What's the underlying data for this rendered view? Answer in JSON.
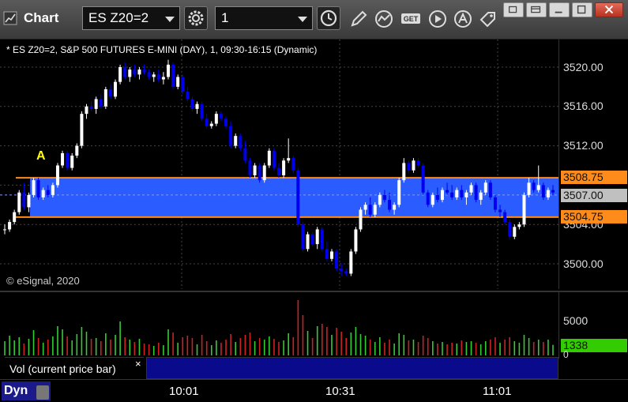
{
  "window": {
    "title": "Chart"
  },
  "toolbar": {
    "symbol_value": "ES Z20=2",
    "interval_value": "1"
  },
  "chart": {
    "title": "* ES Z20=2, S&P 500 FUTURES E-MINI (DAY), 1, 09:30-16:15 (Dynamic)",
    "copyright": "© eSignal, 2020",
    "marker_label": "A",
    "price_axis": {
      "ticks": [
        "3520.00",
        "3516.00",
        "3512.00",
        "3504.00",
        "3500.00"
      ],
      "upper_level": "3508.75",
      "current_price": "3507.00",
      "lower_level": "3504.75"
    },
    "volume_axis": {
      "ticks": [
        "5000",
        "0"
      ],
      "current_volume": "1338"
    },
    "volume_label": "Vol (current price bar)",
    "volume_close": "×",
    "time_axis": [
      "10:01",
      "10:31",
      "11:01"
    ],
    "mode_label": "Dyn",
    "colors": {
      "up_candle": "#ffffff",
      "down_candle": "#0000ee",
      "zone_fill": "#2a5cff",
      "level_line": "#ff8c1a",
      "vol_up": "#33cc33",
      "vol_down": "#cc2222",
      "price_badge": "#ff8c1a",
      "current_badge": "#c0c0c0",
      "vol_badge": "#33cc00"
    }
  },
  "chart_data": {
    "type": "candlestick",
    "title": "* ES Z20=2, S&P 500 FUTURES E-MINI (DAY), 1, 09:30-16:15 (Dynamic)",
    "xlabel": "",
    "ylabel": "",
    "ylim": [
      3497.5,
      3522.5
    ],
    "zone": [
      3504.75,
      3508.75
    ],
    "time_ticks": [
      "10:01",
      "10:31",
      "11:01"
    ],
    "candles": [
      [
        3503.5,
        3504,
        3503,
        3503.5
      ],
      [
        3503.5,
        3504.5,
        3503.25,
        3504.25
      ],
      [
        3504.25,
        3505.5,
        3504,
        3505.25
      ],
      [
        3505.25,
        3507.5,
        3505,
        3507.25
      ],
      [
        3507.25,
        3508.25,
        3505.5,
        3505.75
      ],
      [
        3505.75,
        3507.25,
        3505.25,
        3507
      ],
      [
        3507,
        3508.75,
        3506.75,
        3508.5
      ],
      [
        3508.5,
        3508.75,
        3506.5,
        3506.75
      ],
      [
        3506.75,
        3507.75,
        3506.5,
        3507.5
      ],
      [
        3507.5,
        3508,
        3506.75,
        3507
      ],
      [
        3507,
        3508.25,
        3506.75,
        3508
      ],
      [
        3508,
        3510.25,
        3507.75,
        3510
      ],
      [
        3510,
        3511.5,
        3509.75,
        3511.25
      ],
      [
        3511.25,
        3511.5,
        3509.5,
        3509.75
      ],
      [
        3509.75,
        3511.25,
        3509.5,
        3511
      ],
      [
        3511,
        3512.25,
        3510.75,
        3512
      ],
      [
        3512,
        3515.5,
        3511.75,
        3515.25
      ],
      [
        3515.25,
        3516.25,
        3514.75,
        3516
      ],
      [
        3516,
        3516.5,
        3515.5,
        3515.75
      ],
      [
        3515.75,
        3517,
        3515.25,
        3516.75
      ],
      [
        3516.75,
        3517.25,
        3515.75,
        3516
      ],
      [
        3516,
        3518,
        3515.75,
        3517.75
      ],
      [
        3517.75,
        3518.25,
        3516.75,
        3517
      ],
      [
        3517,
        3518.75,
        3516.75,
        3518.5
      ],
      [
        3518.5,
        3520.25,
        3518.25,
        3520
      ],
      [
        3520,
        3520.5,
        3518.75,
        3519
      ],
      [
        3519,
        3520,
        3518.5,
        3519.75
      ],
      [
        3519.75,
        3520.25,
        3519,
        3519.25
      ],
      [
        3519.25,
        3520,
        3518.75,
        3519.75
      ],
      [
        3519.75,
        3520.25,
        3519.25,
        3519.5
      ],
      [
        3519.5,
        3519.75,
        3518.75,
        3519
      ],
      [
        3519,
        3519.5,
        3518.5,
        3519.25
      ],
      [
        3519.25,
        3519.75,
        3518.5,
        3518.75
      ],
      [
        3518.75,
        3519.5,
        3518.25,
        3519
      ],
      [
        3519,
        3520.75,
        3518.75,
        3520.25
      ],
      [
        3520.25,
        3520.5,
        3517.75,
        3518
      ],
      [
        3518,
        3519.25,
        3517.75,
        3519
      ],
      [
        3519,
        3519.25,
        3517.25,
        3517.5
      ],
      [
        3517.5,
        3518,
        3516.5,
        3516.75
      ],
      [
        3516.75,
        3517,
        3515.5,
        3515.75
      ],
      [
        3515.75,
        3516.5,
        3515.25,
        3516.25
      ],
      [
        3516.25,
        3516.5,
        3514.5,
        3514.75
      ],
      [
        3514.75,
        3515.25,
        3513.75,
        3514
      ],
      [
        3514,
        3514.5,
        3513.75,
        3514.25
      ],
      [
        3514.25,
        3515.5,
        3514,
        3515.25
      ],
      [
        3515.25,
        3515.5,
        3514.5,
        3514.75
      ],
      [
        3514.75,
        3515,
        3513.75,
        3514
      ],
      [
        3514,
        3514.5,
        3511.75,
        3512
      ],
      [
        3512,
        3513.25,
        3511.75,
        3513
      ],
      [
        3513,
        3513.25,
        3511.5,
        3511.75
      ],
      [
        3511.75,
        3512.5,
        3510.25,
        3510.5
      ],
      [
        3510.5,
        3510.75,
        3508.75,
        3509
      ],
      [
        3509,
        3510.25,
        3508.75,
        3510
      ],
      [
        3510,
        3510.25,
        3508.25,
        3508.5
      ],
      [
        3508.5,
        3510.25,
        3508.25,
        3510
      ],
      [
        3510,
        3511.75,
        3509.75,
        3511.5
      ],
      [
        3511.5,
        3511.75,
        3509.5,
        3509.75
      ],
      [
        3509.75,
        3510.25,
        3508.75,
        3509
      ],
      [
        3509,
        3510.75,
        3508.75,
        3510.5
      ],
      [
        3510.5,
        3512.75,
        3510.25,
        3510.75
      ],
      [
        3510.75,
        3511,
        3509.25,
        3509.5
      ],
      [
        3509.5,
        3509.75,
        3503.75,
        3504
      ],
      [
        3504,
        3504.25,
        3501.25,
        3501.5
      ],
      [
        3501.5,
        3503.25,
        3501.25,
        3503
      ],
      [
        3503,
        3503.25,
        3501.75,
        3502
      ],
      [
        3502,
        3503.75,
        3501.5,
        3503.5
      ],
      [
        3503.5,
        3503.75,
        3501.25,
        3501.5
      ],
      [
        3501.5,
        3502.25,
        3500.25,
        3500.5
      ],
      [
        3500.5,
        3501.5,
        3500.25,
        3501.25
      ],
      [
        3501.25,
        3501.5,
        3499.25,
        3499.5
      ],
      [
        3499.5,
        3500,
        3498.75,
        3499.25
      ],
      [
        3499.25,
        3499.5,
        3498.75,
        3499
      ],
      [
        3499,
        3501.5,
        3498.75,
        3501.25
      ],
      [
        3501.25,
        3503.75,
        3501,
        3503.5
      ],
      [
        3503.5,
        3505.75,
        3503.25,
        3505.5
      ],
      [
        3505.5,
        3506.25,
        3505,
        3506
      ],
      [
        3506,
        3506.75,
        3504.75,
        3505
      ],
      [
        3505,
        3506.25,
        3504.75,
        3506
      ],
      [
        3506,
        3507.25,
        3505.75,
        3507
      ],
      [
        3507,
        3507.5,
        3506.25,
        3506.5
      ],
      [
        3506.5,
        3507.25,
        3505.25,
        3505.5
      ],
      [
        3505.5,
        3506.25,
        3505,
        3506
      ],
      [
        3506,
        3508.75,
        3505.75,
        3508.5
      ],
      [
        3508.5,
        3510.75,
        3508.25,
        3510.25
      ],
      [
        3510.25,
        3510.5,
        3509.25,
        3509.5
      ],
      [
        3509.5,
        3510.75,
        3509.25,
        3510.5
      ],
      [
        3510.5,
        3510.75,
        3509.75,
        3510
      ],
      [
        3510,
        3510.25,
        3507,
        3507.25
      ],
      [
        3507.25,
        3507.5,
        3505.75,
        3506
      ],
      [
        3506,
        3507.25,
        3505.75,
        3507
      ],
      [
        3507,
        3507.75,
        3506.25,
        3506.5
      ],
      [
        3506.5,
        3507.75,
        3506.25,
        3507.5
      ],
      [
        3507.5,
        3508.25,
        3507,
        3507.25
      ],
      [
        3507.25,
        3508,
        3506.5,
        3506.75
      ],
      [
        3506.75,
        3507.75,
        3506.5,
        3507.5
      ],
      [
        3507.5,
        3508,
        3506.5,
        3506.75
      ],
      [
        3506.75,
        3507.5,
        3506,
        3507.25
      ],
      [
        3507.25,
        3508.25,
        3507,
        3508
      ],
      [
        3508,
        3508.25,
        3506.25,
        3506.5
      ],
      [
        3506.5,
        3507.5,
        3506,
        3507.25
      ],
      [
        3507.25,
        3508.5,
        3507,
        3508.25
      ],
      [
        3508.25,
        3508.5,
        3506.5,
        3506.75
      ],
      [
        3506.75,
        3507,
        3505.25,
        3505.5
      ],
      [
        3505.5,
        3506,
        3504.75,
        3505.25
      ],
      [
        3505.25,
        3505.5,
        3504,
        3504.25
      ],
      [
        3504.25,
        3504.5,
        3502.5,
        3502.75
      ],
      [
        3502.75,
        3504,
        3502.5,
        3503.75
      ],
      [
        3503.75,
        3504.25,
        3503.5,
        3504
      ],
      [
        3504,
        3507.25,
        3503.75,
        3507
      ],
      [
        3507,
        3508.75,
        3506.75,
        3508.25
      ],
      [
        3508.25,
        3508.5,
        3507.25,
        3507.5
      ],
      [
        3507.5,
        3510,
        3507.25,
        3508
      ],
      [
        3508,
        3508.25,
        3506.5,
        3506.75
      ],
      [
        3506.75,
        3507.75,
        3506.5,
        3507.5
      ],
      [
        3507.5,
        3508,
        3507,
        3507.25
      ]
    ],
    "volume": [
      [
        1800,
        1
      ],
      [
        2500,
        1
      ],
      [
        1900,
        1
      ],
      [
        2300,
        1
      ],
      [
        1500,
        0
      ],
      [
        2100,
        1
      ],
      [
        3200,
        1
      ],
      [
        2200,
        0
      ],
      [
        1600,
        1
      ],
      [
        2000,
        0
      ],
      [
        2400,
        1
      ],
      [
        3700,
        1
      ],
      [
        3300,
        1
      ],
      [
        2400,
        0
      ],
      [
        1900,
        1
      ],
      [
        2700,
        1
      ],
      [
        3600,
        1
      ],
      [
        3000,
        1
      ],
      [
        2100,
        0
      ],
      [
        2200,
        1
      ],
      [
        1800,
        0
      ],
      [
        2800,
        1
      ],
      [
        2000,
        0
      ],
      [
        2600,
        1
      ],
      [
        4300,
        1
      ],
      [
        2300,
        0
      ],
      [
        2000,
        1
      ],
      [
        1700,
        0
      ],
      [
        2100,
        1
      ],
      [
        1500,
        0
      ],
      [
        1400,
        0
      ],
      [
        1200,
        1
      ],
      [
        1600,
        0
      ],
      [
        1300,
        1
      ],
      [
        3300,
        1
      ],
      [
        2900,
        0
      ],
      [
        1600,
        1
      ],
      [
        2300,
        0
      ],
      [
        2500,
        0
      ],
      [
        2200,
        0
      ],
      [
        1400,
        1
      ],
      [
        2600,
        0
      ],
      [
        1800,
        0
      ],
      [
        1300,
        1
      ],
      [
        1900,
        1
      ],
      [
        1600,
        0
      ],
      [
        2000,
        0
      ],
      [
        2700,
        0
      ],
      [
        1700,
        1
      ],
      [
        2200,
        0
      ],
      [
        2600,
        0
      ],
      [
        2900,
        0
      ],
      [
        1800,
        1
      ],
      [
        2200,
        0
      ],
      [
        2000,
        1
      ],
      [
        2400,
        1
      ],
      [
        2100,
        0
      ],
      [
        1700,
        0
      ],
      [
        1900,
        1
      ],
      [
        2800,
        1
      ],
      [
        2300,
        0
      ],
      [
        7000,
        0
      ],
      [
        5100,
        0
      ],
      [
        3100,
        1
      ],
      [
        2200,
        0
      ],
      [
        3700,
        1
      ],
      [
        4000,
        0
      ],
      [
        3600,
        0
      ],
      [
        2600,
        1
      ],
      [
        3500,
        0
      ],
      [
        3000,
        0
      ],
      [
        2200,
        0
      ],
      [
        2900,
        1
      ],
      [
        3600,
        1
      ],
      [
        2700,
        1
      ],
      [
        2500,
        1
      ],
      [
        2000,
        0
      ],
      [
        1700,
        1
      ],
      [
        2300,
        1
      ],
      [
        1600,
        0
      ],
      [
        2000,
        0
      ],
      [
        1500,
        1
      ],
      [
        2800,
        1
      ],
      [
        2600,
        1
      ],
      [
        1900,
        0
      ],
      [
        2000,
        1
      ],
      [
        1700,
        0
      ],
      [
        2500,
        0
      ],
      [
        2200,
        0
      ],
      [
        1800,
        1
      ],
      [
        1500,
        0
      ],
      [
        1700,
        1
      ],
      [
        1400,
        0
      ],
      [
        1600,
        0
      ],
      [
        1500,
        1
      ],
      [
        1900,
        0
      ],
      [
        1700,
        1
      ],
      [
        1800,
        1
      ],
      [
        1600,
        0
      ],
      [
        1400,
        1
      ],
      [
        1800,
        1
      ],
      [
        2000,
        0
      ],
      [
        2300,
        0
      ],
      [
        1600,
        1
      ],
      [
        2000,
        0
      ],
      [
        2300,
        0
      ],
      [
        1800,
        1
      ],
      [
        1600,
        1
      ],
      [
        2600,
        1
      ],
      [
        2200,
        1
      ],
      [
        1700,
        0
      ],
      [
        2000,
        1
      ],
      [
        1700,
        0
      ],
      [
        2000,
        1
      ],
      [
        1338,
        1
      ]
    ],
    "volume_ylim": [
      0,
      8000
    ]
  }
}
